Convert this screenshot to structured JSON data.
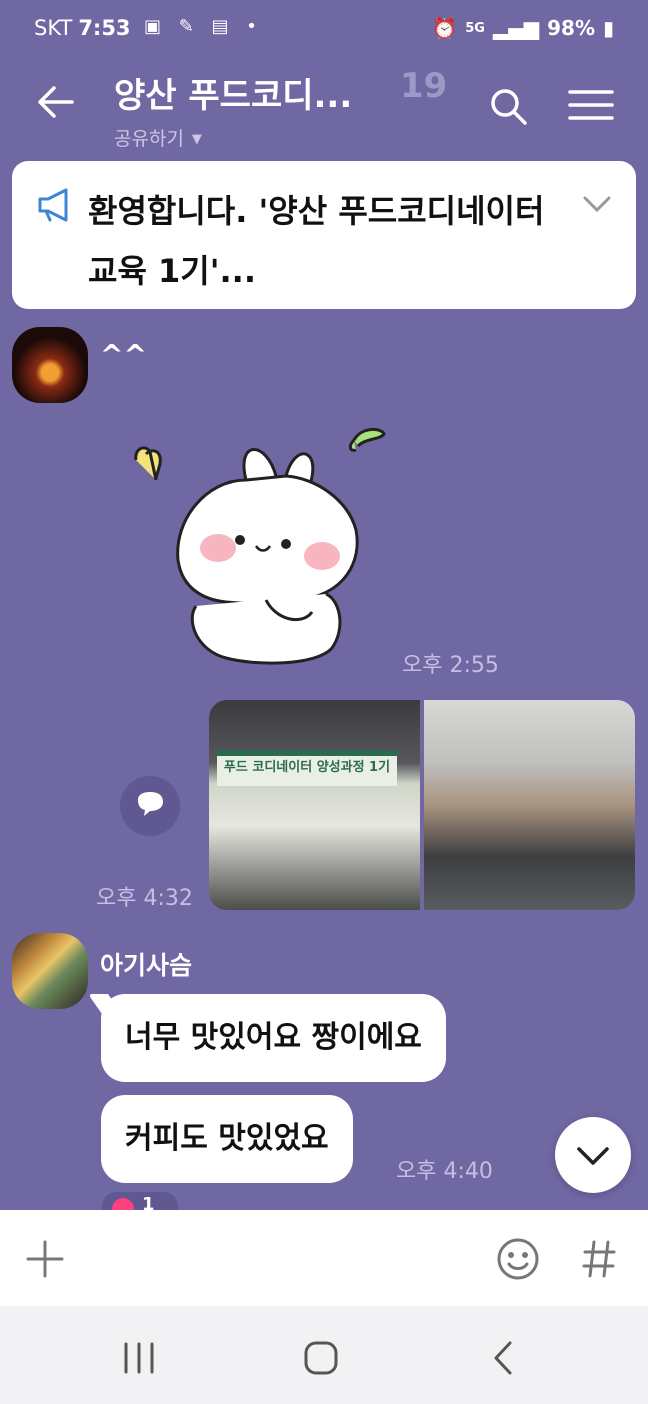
{
  "status_bar": {
    "carrier": "SKT",
    "time": "7:53",
    "network": "5G",
    "battery": "98%"
  },
  "header": {
    "title": "양산 푸드코디...",
    "member_count": "19",
    "share_label": "공유하기"
  },
  "notice": {
    "text": "환영합니다. '양산 푸드코디네이터 교육 1기'..."
  },
  "messages": {
    "m1": {
      "text": "^^",
      "time": "오후 2:55"
    },
    "photo": {
      "time": "오후 4:32",
      "banner": "푸드 코디네이터 양성과정 1기"
    },
    "m2": {
      "sender": "아기사슴",
      "bubble1": "너무 맛있어요 짱이에요",
      "bubble2": "커피도 맛있었요",
      "time": "오후 4:40",
      "reaction_count": "1"
    }
  },
  "colors": {
    "background": "#6f68a3",
    "bubble": "#ffffff",
    "reaction": "#ff3f7e"
  }
}
